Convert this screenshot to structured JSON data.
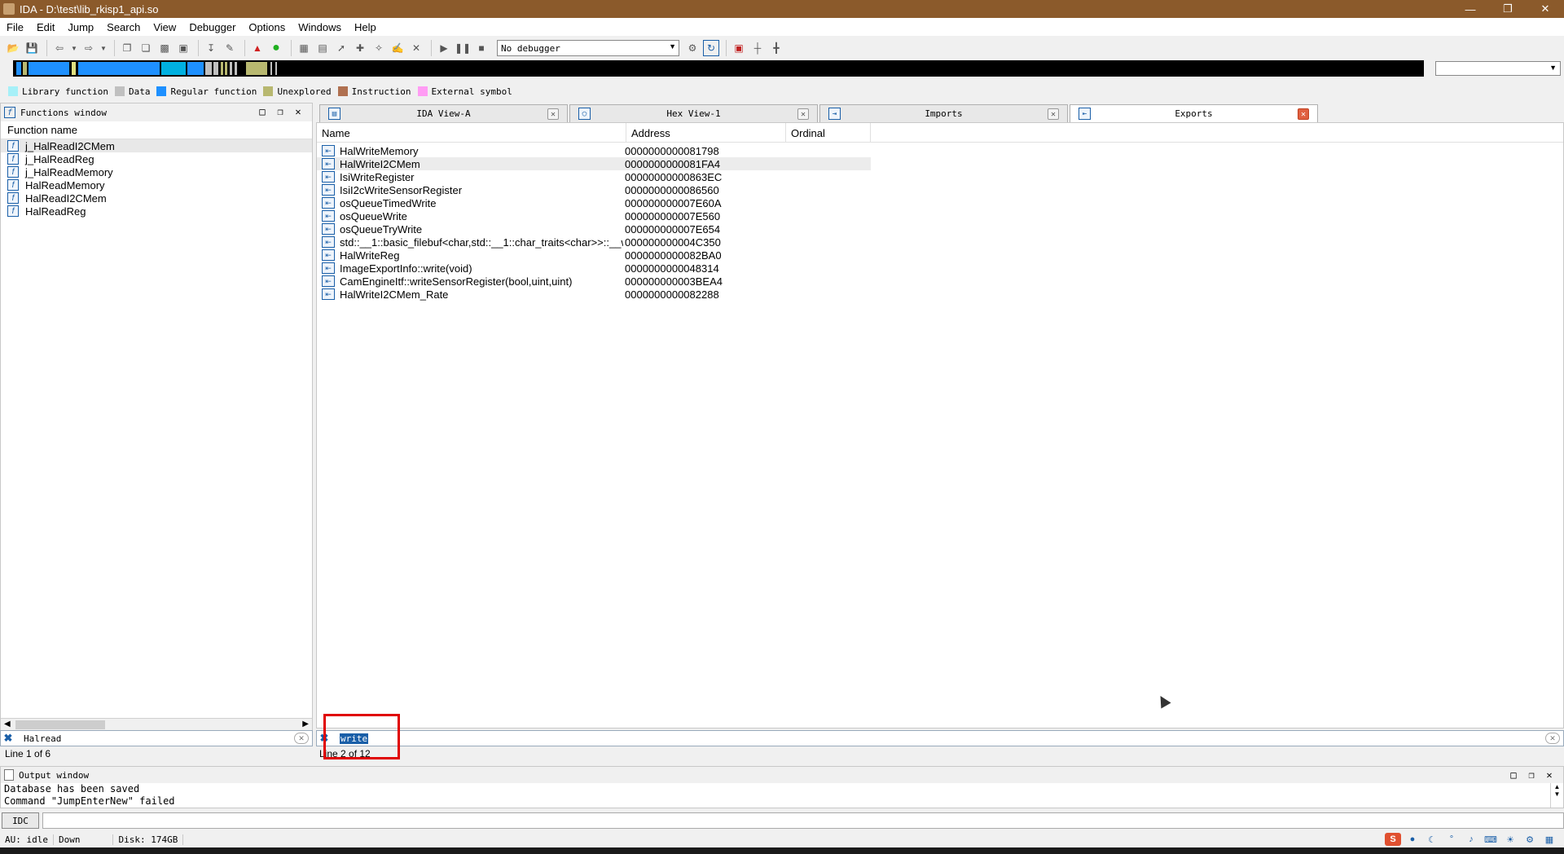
{
  "window": {
    "title": "IDA - D:\\test\\lib_rkisp1_api.so",
    "buttons": [
      "—",
      "❐",
      "✕"
    ]
  },
  "menu": [
    "File",
    "Edit",
    "Jump",
    "Search",
    "View",
    "Debugger",
    "Options",
    "Windows",
    "Help"
  ],
  "toolbar": {
    "debugger_select": "No debugger"
  },
  "legend": [
    {
      "label": "Library function",
      "color": "#a6f0f8"
    },
    {
      "label": "Data",
      "color": "#c0c0c0"
    },
    {
      "label": "Regular function",
      "color": "#1e90ff"
    },
    {
      "label": "Unexplored",
      "color": "#b8b870"
    },
    {
      "label": "Instruction",
      "color": "#b07050"
    },
    {
      "label": "External symbol",
      "color": "#ff9cf4"
    }
  ],
  "functions_window": {
    "title": "Functions window",
    "column": "Function name",
    "items": [
      "j_HalReadI2CMem",
      "j_HalReadReg",
      "j_HalReadMemory",
      "HalReadMemory",
      "HalReadI2CMem",
      "HalReadReg"
    ],
    "filter": "Halread",
    "status": "Line 1 of 6"
  },
  "tabs": [
    {
      "label": "IDA View-A",
      "icon": "ida-view-icon",
      "active": false
    },
    {
      "label": "Hex View-1",
      "icon": "hex-view-icon",
      "active": false
    },
    {
      "label": "Imports",
      "icon": "imports-icon",
      "active": false
    },
    {
      "label": "Exports",
      "icon": "exports-icon",
      "active": true
    }
  ],
  "exports": {
    "columns": [
      "Name",
      "Address",
      "Ordinal"
    ],
    "rows": [
      {
        "name": "HalWriteMemory",
        "address": "0000000000081798",
        "ordinal": ""
      },
      {
        "name": "HalWriteI2CMem",
        "address": "0000000000081FA4",
        "ordinal": ""
      },
      {
        "name": "IsiWriteRegister",
        "address": "00000000000863EC",
        "ordinal": ""
      },
      {
        "name": "IsiI2cWriteSensorRegister",
        "address": "0000000000086560",
        "ordinal": ""
      },
      {
        "name": "osQueueTimedWrite",
        "address": "000000000007E60A",
        "ordinal": ""
      },
      {
        "name": "osQueueWrite",
        "address": "000000000007E560",
        "ordinal": ""
      },
      {
        "name": "osQueueTryWrite",
        "address": "000000000007E654",
        "ordinal": ""
      },
      {
        "name": "std::__1::basic_filebuf<char,std::__1::char_traits<char>>::__w...",
        "address": "000000000004C350",
        "ordinal": ""
      },
      {
        "name": "HalWriteReg",
        "address": "0000000000082BA0",
        "ordinal": ""
      },
      {
        "name": "ImageExportInfo::write(void)",
        "address": "0000000000048314",
        "ordinal": ""
      },
      {
        "name": "CamEngineItf::writeSensorRegister(bool,uint,uint)",
        "address": "000000000003BEA4",
        "ordinal": ""
      },
      {
        "name": "HalWriteI2CMem_Rate",
        "address": "0000000000082288",
        "ordinal": ""
      }
    ],
    "filter": "write",
    "status": "Line 2 of 12"
  },
  "output_window": {
    "title": "Output window",
    "lines": [
      "Database has been saved",
      "Command \"JumpEnterNew\" failed"
    ]
  },
  "command": {
    "button": "IDC"
  },
  "statusbar": {
    "au": "AU:  idle",
    "direction": "Down",
    "disk": "Disk: 174GB"
  }
}
